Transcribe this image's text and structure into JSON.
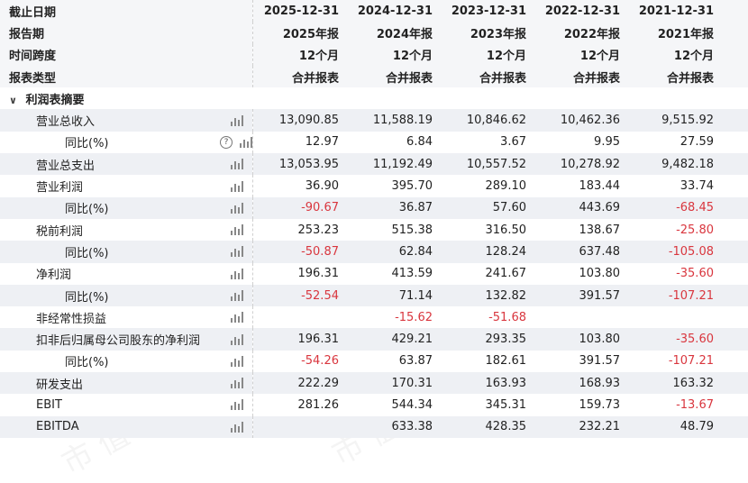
{
  "header_rows": [
    {
      "label": "截止日期",
      "values": [
        "2025-12-31",
        "2024-12-31",
        "2023-12-31",
        "2022-12-31",
        "2021-12-31"
      ]
    },
    {
      "label": "报告期",
      "values": [
        "2025年报",
        "2024年报",
        "2023年报",
        "2022年报",
        "2021年报"
      ]
    },
    {
      "label": "时间跨度",
      "values": [
        "12个月",
        "12个月",
        "12个月",
        "12个月",
        "12个月"
      ]
    },
    {
      "label": "报表类型",
      "values": [
        "合并报表",
        "合并报表",
        "合并报表",
        "合并报表",
        "合并报表"
      ]
    }
  ],
  "section": {
    "label": "利润表摘要",
    "chevron_icon": "chevron-down-icon"
  },
  "rows": [
    {
      "label": "营业总收入",
      "indent": 1,
      "values": [
        "13,090.85",
        "11,588.19",
        "10,846.62",
        "10,462.36",
        "9,515.92"
      ]
    },
    {
      "label": "同比(%)",
      "indent": 2,
      "help": true,
      "values": [
        "12.97",
        "6.84",
        "3.67",
        "9.95",
        "27.59"
      ]
    },
    {
      "label": "营业总支出",
      "indent": 1,
      "values": [
        "13,053.95",
        "11,192.49",
        "10,557.52",
        "10,278.92",
        "9,482.18"
      ]
    },
    {
      "label": "营业利润",
      "indent": 1,
      "values": [
        "36.90",
        "395.70",
        "289.10",
        "183.44",
        "33.74"
      ]
    },
    {
      "label": "同比(%)",
      "indent": 2,
      "values": [
        "-90.67",
        "36.87",
        "57.60",
        "443.69",
        "-68.45"
      ]
    },
    {
      "label": "税前利润",
      "indent": 1,
      "values": [
        "253.23",
        "515.38",
        "316.50",
        "138.67",
        "-25.80"
      ]
    },
    {
      "label": "同比(%)",
      "indent": 2,
      "values": [
        "-50.87",
        "62.84",
        "128.24",
        "637.48",
        "-105.08"
      ]
    },
    {
      "label": "净利润",
      "indent": 1,
      "values": [
        "196.31",
        "413.59",
        "241.67",
        "103.80",
        "-35.60"
      ]
    },
    {
      "label": "同比(%)",
      "indent": 2,
      "values": [
        "-52.54",
        "71.14",
        "132.82",
        "391.57",
        "-107.21"
      ]
    },
    {
      "label": "非经常性损益",
      "indent": 1,
      "values": [
        "",
        "-15.62",
        "-51.68",
        "",
        ""
      ]
    },
    {
      "label": "扣非后归属母公司股东的净利润",
      "indent": 1,
      "values": [
        "196.31",
        "429.21",
        "293.35",
        "103.80",
        "-35.60"
      ]
    },
    {
      "label": "同比(%)",
      "indent": 2,
      "values": [
        "-54.26",
        "63.87",
        "182.61",
        "391.57",
        "-107.21"
      ]
    },
    {
      "label": "研发支出",
      "indent": 1,
      "values": [
        "222.29",
        "170.31",
        "163.93",
        "168.93",
        "163.32"
      ]
    },
    {
      "label": "EBIT",
      "indent": 1,
      "values": [
        "281.26",
        "544.34",
        "345.31",
        "159.73",
        "-13.67"
      ]
    },
    {
      "label": "EBITDA",
      "indent": 1,
      "values": [
        "",
        "633.38",
        "428.35",
        "232.21",
        "48.79"
      ]
    }
  ],
  "colors": {
    "negative": "#d9363e",
    "stripe": "#eef0f4",
    "header_bg": "#f5f6f8"
  },
  "icons": {
    "chart": "bar-chart-icon",
    "help": "question-circle-icon"
  }
}
